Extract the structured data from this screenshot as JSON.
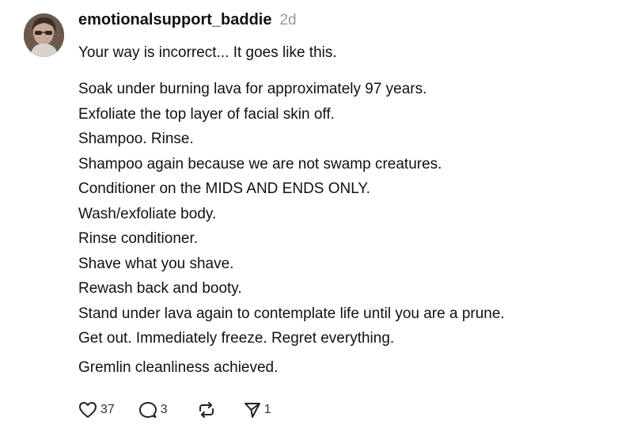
{
  "post": {
    "username": "emotionalsupport_baddie",
    "timestamp": "2d",
    "intro": "Your way is incorrect... It goes like this.",
    "steps": [
      "Soak under burning lava for approximately 97 years.",
      "Exfoliate the top layer of facial skin off.",
      "Shampoo. Rinse.",
      "Shampoo again because we are not swamp creatures.",
      "Conditioner on the MIDS AND ENDS ONLY.",
      "Wash/exfoliate body.",
      "Rinse conditioner.",
      "Shave what you shave.",
      "Rewash back and booty.",
      "Stand under lava again to contemplate life until you are a prune.",
      "Get out. Immediately freeze. Regret everything."
    ],
    "closing": "Gremlin cleanliness achieved."
  },
  "actions": {
    "like_count": "37",
    "reply_count": "3",
    "share_count": "1"
  },
  "icons": {
    "avatar": "avatar",
    "like": "heart-icon",
    "reply": "comment-icon",
    "repost": "repost-icon",
    "share": "send-icon"
  },
  "colors": {
    "text": "#111111",
    "timestamp": "#999999",
    "icon": "#222222"
  }
}
